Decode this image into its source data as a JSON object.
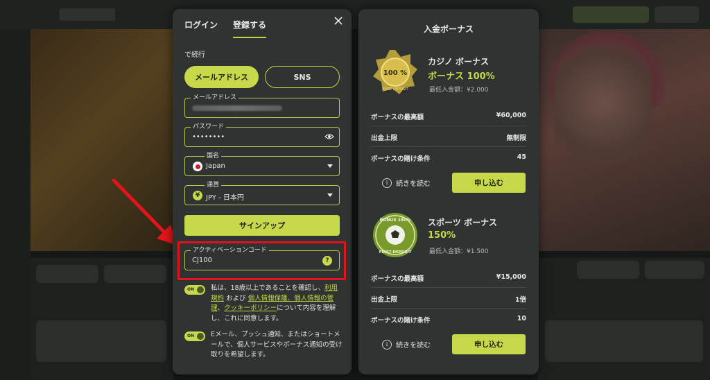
{
  "login": {
    "tabs": {
      "login": "ログイン",
      "register": "登録する"
    },
    "continue_label": "で続行",
    "method_email": "メールアドレス",
    "method_sns": "SNS",
    "email_legend": "メールアドレス",
    "password_legend": "パスワード",
    "password_value": "••••••••",
    "country_legend": "国名",
    "country_value": "Japan",
    "currency_legend": "通貨",
    "currency_symbol": "¥",
    "currency_value": "JPY - 日本円",
    "signup_label": "サインアップ",
    "activation_legend": "アクティベーションコード",
    "activation_value": "CJ100",
    "help_symbol": "?",
    "toggle_on_label": "ON",
    "consent1": {
      "pre": "私は、18歳以上であることを確認し、",
      "link_terms": "利用規約",
      "and": " および ",
      "link_privacy": "個人情報保護、個人情報の管理",
      "comma": "、",
      "link_cookie": "クッキーポリシー",
      "post": "について内容を理解し、これに同意します。"
    },
    "consent2": "Eメール、プッシュ通知、またはショートメールで、個人サービスやボーナス通知の受け取りを希望します。"
  },
  "bonus": {
    "title": "入金ボーナス",
    "casino": {
      "name": "カジノ ボーナス",
      "percent": "ボーナス 100%",
      "min_deposit": "最低入金額：¥2.000",
      "badge_text": "100 %",
      "badge_sub": "FIRST DEPOSIT",
      "rows": [
        {
          "label": "ボーナスの最高額",
          "value": "¥60,000"
        },
        {
          "label": "出金上限",
          "value": "無制限"
        },
        {
          "label": "ボーナスの賭け条件",
          "value": "45"
        }
      ],
      "read_more": "続きを読む",
      "apply": "申し込む"
    },
    "sports": {
      "name": "スポーツ ボーナス",
      "percent": "150%",
      "min_deposit": "最低入金額：¥1.500",
      "badge_top": "BONUS 150%",
      "badge_bottom": "FIRST DEPOSIT",
      "rows": [
        {
          "label": "ボーナスの最高額",
          "value": "¥15,000"
        },
        {
          "label": "出金上限",
          "value": "1倍"
        },
        {
          "label": "ボーナスの賭け条件",
          "value": "10"
        }
      ],
      "read_more": "続きを読む",
      "apply": "申し込む"
    },
    "info_symbol": "i"
  },
  "colors": {
    "accent": "#c7d84a",
    "highlight_frame": "#e3141b",
    "panel": "#2f3331"
  }
}
